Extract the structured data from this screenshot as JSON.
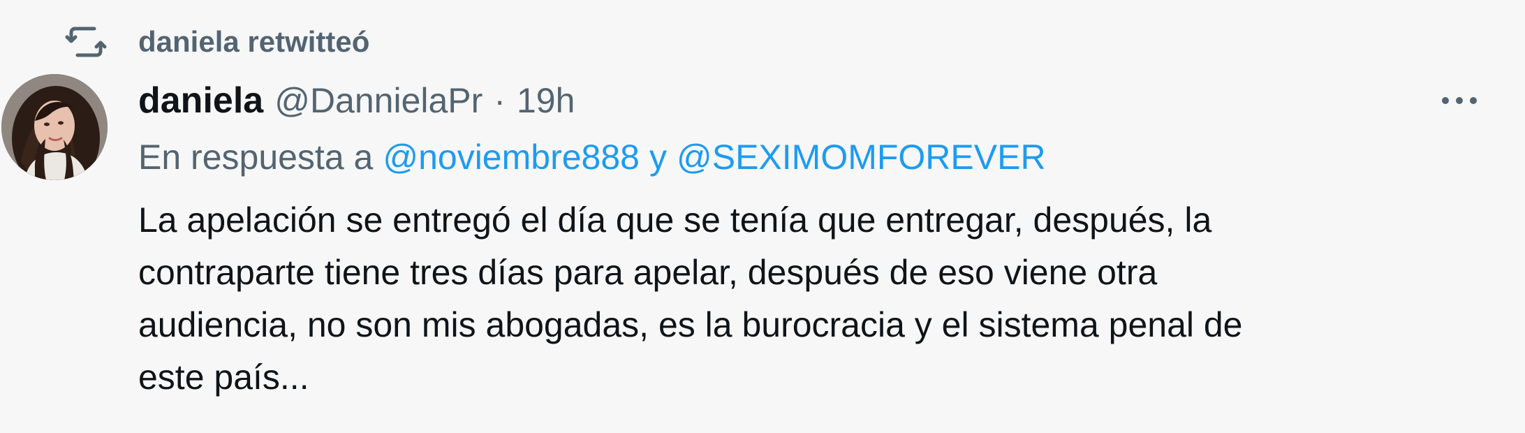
{
  "retweet": {
    "icon": "retweet-icon",
    "label": "daniela retwitteó"
  },
  "author": {
    "avatar_icon": "avatar",
    "name": "daniela",
    "handle": "@DannielaPr",
    "separator": "·",
    "time": "19h"
  },
  "reply": {
    "prefix": "En respuesta a",
    "mention_1": "@noviembre888",
    "joiner": "y",
    "mention_2": "@SEXIMOMFOREVER"
  },
  "tweet": {
    "lines": [
      "La apelación se entregó el día que se tenía que entregar, después, la",
      "contraparte tiene tres días para apelar, después de eso viene otra",
      "audiencia, no son mis abogadas, es la burocracia y el sistema penal de",
      "este país..."
    ]
  },
  "actions": {
    "more_icon": "more-icon"
  },
  "colors": {
    "background": "#f7f7f7",
    "text_primary": "#0f1419",
    "text_secondary": "#536471",
    "link": "#1d9bf0"
  }
}
